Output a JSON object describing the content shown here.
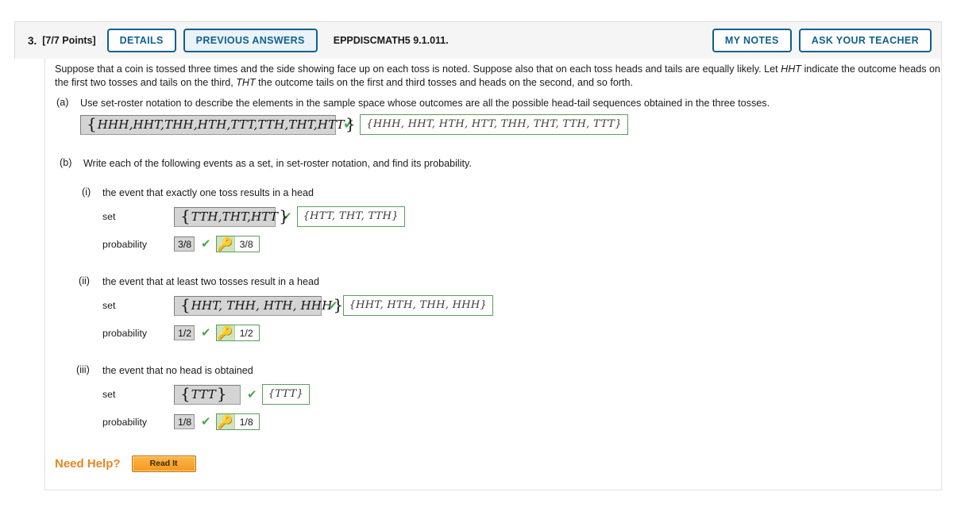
{
  "header": {
    "number": "3.",
    "points": "[7/7 Points]",
    "details_label": "DETAILS",
    "previous_answers_label": "PREVIOUS ANSWERS",
    "question_code": "EPPDISCMATH5 9.1.011.",
    "my_notes_label": "MY NOTES",
    "ask_your_teacher_label": "ASK YOUR TEACHER",
    "accent_color": "#10608f"
  },
  "prompt": {
    "text_1": "Suppose that a coin is tossed three times and the side showing face up on each toss is noted. Suppose also that on each toss heads and tails are equally likely. Let ",
    "em_1": "HHT",
    "text_2": " indicate the outcome heads on the first two tosses and tails on the third, ",
    "em_2": "THT",
    "text_3": " the outcome tails on the first and third tosses and heads on the second, and so forth."
  },
  "parts": {
    "a": {
      "label": "(a)",
      "text": "Use set-roster notation to describe the elements in the sample space whose outcomes are all the possible head-tail sequences obtained in the three tosses.",
      "answer_entered": "HHH,HHT,THH,HTH,TTT,TTH,THT,HTT",
      "correct_answer": "{HHH, HHT, HTH, HTT, THH, THT, TTH, TTT}",
      "status_icon": "check-icon"
    },
    "b": {
      "label": "(b)",
      "text": "Write each of the following events as a set, in set-roster notation, and find its probability.",
      "items": [
        {
          "label": "(i)",
          "text": "the event that exactly one toss results in a head",
          "set_label": "set",
          "set_entered": "TTH,THT,HTT",
          "set_correct": "{HTT, THT, TTH}",
          "probability_label": "probability",
          "probability_entered": "3/8",
          "probability_correct": "3/8",
          "status_icon": "check-icon",
          "key_icon": "key-icon"
        },
        {
          "label": "(ii)",
          "text": "the event that at least two tosses result in a head",
          "set_label": "set",
          "set_entered": "HHT, THH, HTH, HHH",
          "set_correct": "{HHT, HTH, THH, HHH}",
          "probability_label": "probability",
          "probability_entered": "1/2",
          "probability_correct": "1/2",
          "status_icon": "check-icon",
          "key_icon": "key-icon"
        },
        {
          "label": "(iii)",
          "text": "the event that no head is obtained",
          "set_label": "set",
          "set_entered": "TTT",
          "set_correct": "{TTT}",
          "probability_label": "probability",
          "probability_entered": "1/8",
          "probability_correct": "1/8",
          "status_icon": "check-icon",
          "key_icon": "key-icon"
        }
      ]
    }
  },
  "need_help": {
    "label": "Need Help?",
    "read_it_label": "Read It",
    "label_color": "#e8861e"
  },
  "icons": {
    "check": "✔",
    "key": "🔑"
  }
}
